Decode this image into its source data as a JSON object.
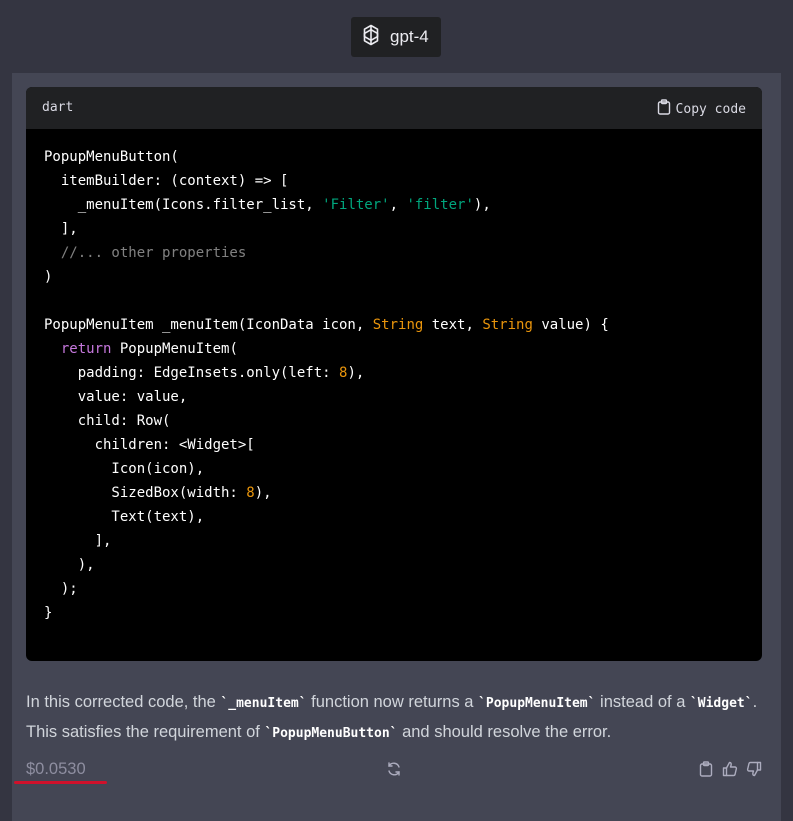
{
  "model": {
    "name": "gpt-4"
  },
  "code_block": {
    "language": "dart",
    "copy_label": "Copy code",
    "lines": [
      [
        [
          "",
          "PopupMenuButton("
        ]
      ],
      [
        [
          "",
          "  itemBuilder: (context) => ["
        ]
      ],
      [
        [
          "",
          "    _menuItem(Icons.filter_list, "
        ],
        [
          "str",
          "'Filter'"
        ],
        [
          "",
          ", "
        ],
        [
          "str",
          "'filter'"
        ],
        [
          "",
          "),"
        ]
      ],
      [
        [
          "",
          "  ],"
        ]
      ],
      [
        [
          "cmt",
          "  //... other properties"
        ]
      ],
      [
        [
          "",
          ")"
        ]
      ],
      [
        [
          "",
          ""
        ]
      ],
      [
        [
          "",
          "PopupMenuItem _menuItem(IconData icon, "
        ],
        [
          "orange",
          "String"
        ],
        [
          "",
          " text, "
        ],
        [
          "orange",
          "String"
        ],
        [
          "",
          " value) {"
        ]
      ],
      [
        [
          "",
          "  "
        ],
        [
          "purple",
          "return"
        ],
        [
          "",
          " PopupMenuItem("
        ]
      ],
      [
        [
          "",
          "    padding: EdgeInsets.only(left: "
        ],
        [
          "orange",
          "8"
        ],
        [
          "",
          "),"
        ]
      ],
      [
        [
          "",
          "    value: value,"
        ]
      ],
      [
        [
          "",
          "    child: Row("
        ]
      ],
      [
        [
          "",
          "      children: <Widget>["
        ]
      ],
      [
        [
          "",
          "        Icon(icon),"
        ]
      ],
      [
        [
          "",
          "        SizedBox(width: "
        ],
        [
          "orange",
          "8"
        ],
        [
          "",
          "),"
        ]
      ],
      [
        [
          "",
          "        Text(text),"
        ]
      ],
      [
        [
          "",
          "      ],"
        ]
      ],
      [
        [
          "",
          "    ),"
        ]
      ],
      [
        [
          "",
          "  );"
        ]
      ],
      [
        [
          "",
          "}"
        ]
      ]
    ]
  },
  "answer": {
    "p1": "In this corrected code, the ",
    "c1": "`_menuItem`",
    "p2": " function now returns a ",
    "c2": "`PopupMenuItem`",
    "p3": " instead of a ",
    "c3": "`Widget`",
    "p4": ". This satisfies the requirement of ",
    "c4": "`PopupMenuButton`",
    "p5": " and should resolve the error."
  },
  "footer": {
    "cost": "$0.0530",
    "icons": [
      "regenerate-icon",
      "clipboard-icon",
      "thumbs-up-icon",
      "thumbs-down-icon"
    ]
  },
  "colors": {
    "background": "#343541",
    "message_bg": "#444654",
    "code_bg": "#000000",
    "string": "#00a67d",
    "keyword_orange": "#e9950c",
    "keyword_purple": "#c678dd",
    "underline": "#d0112b"
  }
}
